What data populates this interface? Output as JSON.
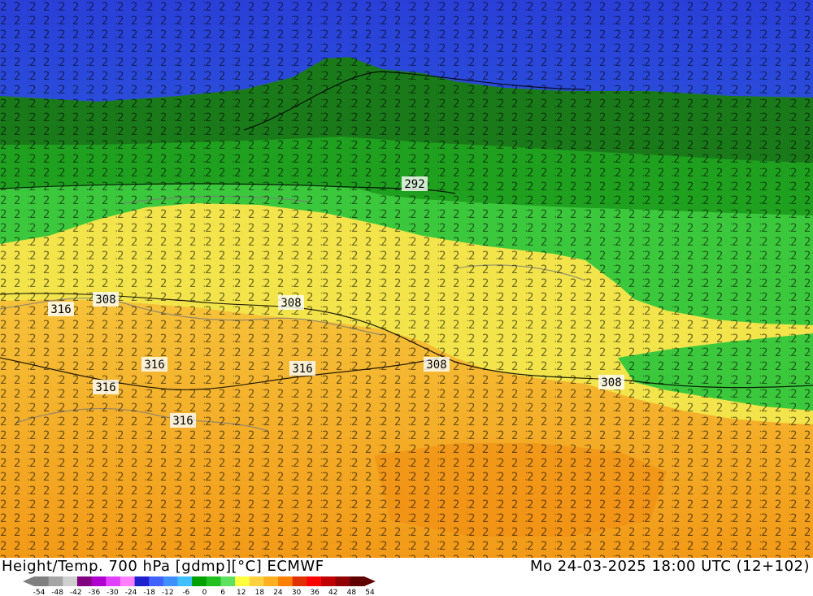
{
  "header": {
    "title_left": "Height/Temp. 700 hPa [gdmp][°C] ECMWF",
    "title_right": "Mo 24-03-2025 18:00 UTC (12+102)"
  },
  "contour_labels": [
    "316",
    "308",
    "308",
    "316",
    "316",
    "316",
    "308",
    "316",
    "308",
    "292"
  ],
  "colorbar": {
    "ticks": [
      "-54",
      "-48",
      "-42",
      "-36",
      "-30",
      "-24",
      "-18",
      "-12",
      "-6",
      "0",
      "6",
      "12",
      "18",
      "24",
      "30",
      "36",
      "42",
      "48",
      "54"
    ],
    "colors": [
      "#7f7f7f",
      "#a5a5a5",
      "#cfcfcf",
      "#800080",
      "#b000d0",
      "#e040ff",
      "#ff80ff",
      "#2020d0",
      "#4060ff",
      "#4090ff",
      "#40c0ff",
      "#00a000",
      "#20c020",
      "#60e060",
      "#ffff40",
      "#ffd040",
      "#ffb020",
      "#ff8000",
      "#e03000",
      "#ff0000",
      "#c00000",
      "#900000",
      "#600000"
    ]
  },
  "field_colors": {
    "blue_top": "#2a3fd8",
    "blue_mid": "#2e86e8",
    "green_dark": "#1a7a1a",
    "green_mid": "#1fa01f",
    "green_light": "#3cc83c",
    "yellow": "#f2e44a",
    "orange": "#f4a41c",
    "sea_line": "#8a8a8a"
  }
}
